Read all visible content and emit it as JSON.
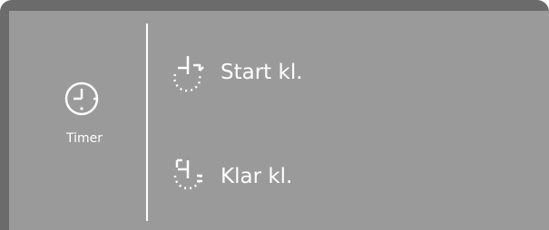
{
  "timer": {
    "label": "Timer",
    "icon": "clock-icon"
  },
  "menu": {
    "items": [
      {
        "label": "Start kl.",
        "icon": "start-time-icon"
      },
      {
        "label": "Klar kl.",
        "icon": "finish-time-icon"
      }
    ]
  },
  "colors": {
    "bezel": "#6b6b6b",
    "screen": "#9a9a9a",
    "text": "#ffffff"
  }
}
